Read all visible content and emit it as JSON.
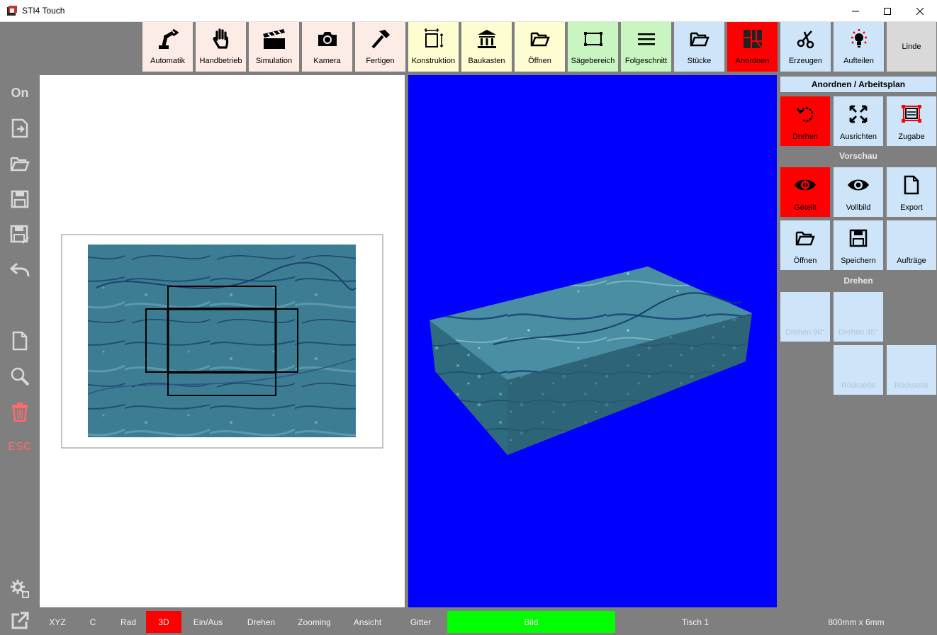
{
  "window": {
    "title": "STI4 Touch"
  },
  "colors": {
    "pink": "#fdebe6",
    "yellow": "#fdfdd1",
    "green": "#c8f5c0",
    "blue": "#cde4f9",
    "red": "#ff0000",
    "grey": "#7f7f7f",
    "lime": "#00ff00",
    "viewport_blue": "#0000ff"
  },
  "left_toolbar": {
    "on_label": "On",
    "esc_label": "ESC",
    "icons": [
      "export-icon",
      "folder-open-icon",
      "save-icon",
      "save-as-icon",
      "undo-icon",
      "new-document-icon",
      "zoom-icon",
      "trash-icon",
      "settings-icon",
      "open-external-icon"
    ]
  },
  "toolbar": {
    "items": [
      {
        "label": "Automatik",
        "icon": "robot-arm-icon"
      },
      {
        "label": "Handbetrieb",
        "icon": "hand-icon"
      },
      {
        "label": "Simulation",
        "icon": "clapperboard-icon"
      },
      {
        "label": "Kamera",
        "icon": "camera-icon"
      },
      {
        "label": "Fertigen",
        "icon": "hammer-icon"
      },
      {
        "label": "Konstruktion",
        "icon": "dimension-icon"
      },
      {
        "label": "Baukasten",
        "icon": "building-icon"
      },
      {
        "label": "Öffnen",
        "icon": "folder-open-icon"
      },
      {
        "label": "Sägebereich",
        "icon": "saw-area-icon"
      },
      {
        "label": "Folgeschnitt",
        "icon": "menu-lines-icon"
      },
      {
        "label": "Stücke",
        "icon": "folder-icon"
      },
      {
        "label": "Anordnen",
        "icon": "layout-grid-icon"
      },
      {
        "label": "Erzeugen",
        "icon": "scissors-icon"
      },
      {
        "label": "Aufteilen",
        "icon": "lightbulb-icon"
      },
      {
        "label": "Linde",
        "icon": ""
      }
    ]
  },
  "right_panel": {
    "header": "Anordnen / Arbeitsplan",
    "row1": [
      {
        "label": "Drehen",
        "icon": "rotate-icon"
      },
      {
        "label": "Ausrichten",
        "icon": "expand-icon"
      },
      {
        "label": "Zugabe",
        "icon": "allowance-icon"
      }
    ],
    "preview_title": "Vorschau",
    "row2": [
      {
        "label": "Geteilt",
        "icon": "eye-split-icon"
      },
      {
        "label": "Vollbild",
        "icon": "eye-icon"
      },
      {
        "label": "Export",
        "icon": "document-icon"
      }
    ],
    "row3": [
      {
        "label": "Öffnen",
        "icon": "folder-open-icon"
      },
      {
        "label": "Speichern",
        "icon": "save-icon"
      },
      {
        "label": "Aufträge",
        "icon": ""
      }
    ],
    "rotate_title": "Drehen",
    "row4": [
      {
        "label": "Drehen 90°"
      },
      {
        "label": "Drehen 45°"
      }
    ],
    "row5": [
      {
        "label": "Rückseite"
      },
      {
        "label": "Rückseite"
      }
    ]
  },
  "statusbar": {
    "items": [
      "XYZ",
      "C",
      "Rad",
      "3D",
      "Ein/Aus",
      "Drehen",
      "Zooming",
      "Ansicht",
      "Gitter"
    ],
    "active": "3D",
    "bild": "Bild",
    "table": "Tisch 1",
    "dimensions": "800mm x 6mm"
  }
}
